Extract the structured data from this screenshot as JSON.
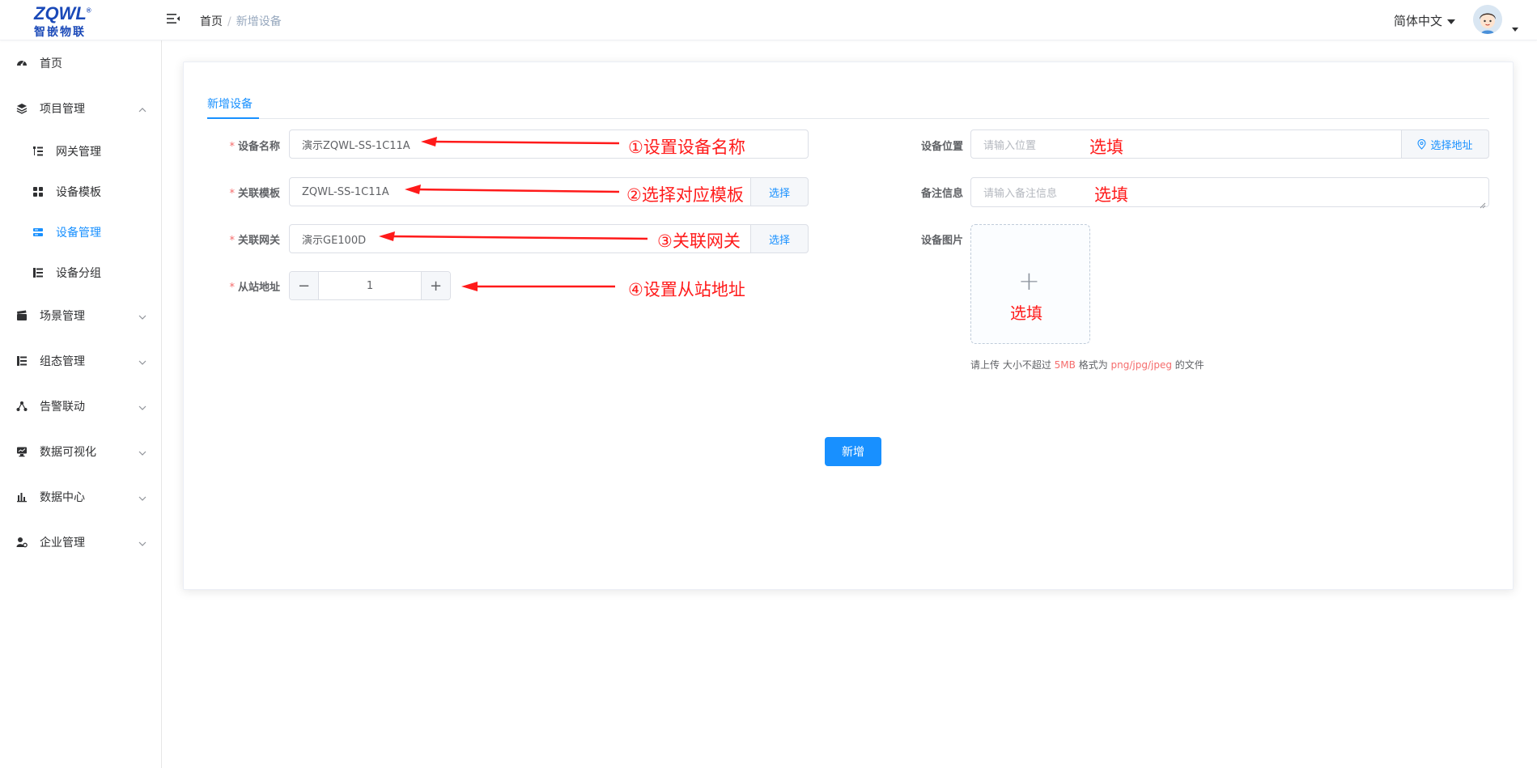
{
  "header": {
    "logo_text": "ZQWL",
    "logo_sub": "智嵌物联",
    "breadcrumb": {
      "home": "首页",
      "separator": "/",
      "current": "新增设备"
    },
    "language": "简体中文"
  },
  "sidebar": {
    "items": [
      {
        "label": "首页",
        "icon": "dashboard-icon"
      },
      {
        "label": "项目管理",
        "icon": "layers-icon",
        "expanded": true,
        "children": [
          {
            "label": "网关管理",
            "icon": "tree-list-icon"
          },
          {
            "label": "设备模板",
            "icon": "grid-icon"
          },
          {
            "label": "设备管理",
            "icon": "server-icon",
            "active": true
          },
          {
            "label": "设备分组",
            "icon": "group-list-icon"
          }
        ]
      },
      {
        "label": "场景管理",
        "icon": "clapper-icon"
      },
      {
        "label": "组态管理",
        "icon": "tree-list-icon"
      },
      {
        "label": "告警联动",
        "icon": "share-icon"
      },
      {
        "label": "数据可视化",
        "icon": "monitor-icon"
      },
      {
        "label": "数据中心",
        "icon": "bar-chart-icon"
      },
      {
        "label": "企业管理",
        "icon": "user-settings-icon"
      }
    ]
  },
  "tab": "新增设备",
  "form": {
    "device_name": {
      "label": "设备名称",
      "value": "演示ZQWL-SS-1C11A"
    },
    "template": {
      "label": "关联模板",
      "value": "ZQWL-SS-1C11A",
      "button": "选择"
    },
    "gateway": {
      "label": "关联网关",
      "value": "演示GE100D",
      "button": "选择"
    },
    "slave_address": {
      "label": "从站地址",
      "value": "1",
      "minus": "−",
      "plus": "+"
    },
    "location": {
      "label": "设备位置",
      "placeholder": "请输入位置",
      "button": "选择地址"
    },
    "remark": {
      "label": "备注信息",
      "placeholder": "请输入备注信息"
    },
    "image": {
      "label": "设备图片",
      "plus": "+"
    },
    "tip": {
      "prefix": "请上传 大小不超过 ",
      "size": "5MB",
      "middle": " 格式为 ",
      "formats": "png/jpg/jpeg",
      "suffix": " 的文件"
    },
    "submit": "新增"
  },
  "annotations": {
    "step1": "①设置设备名称",
    "step2": "②选择对应模板",
    "step3": "③关联网关",
    "step4": "④设置从站地址",
    "optional": "选填"
  },
  "colors": {
    "accent": "#1890ff",
    "annotation": "#ff1a1a",
    "required": "#f56c6c",
    "brand": "#1a49b8"
  }
}
